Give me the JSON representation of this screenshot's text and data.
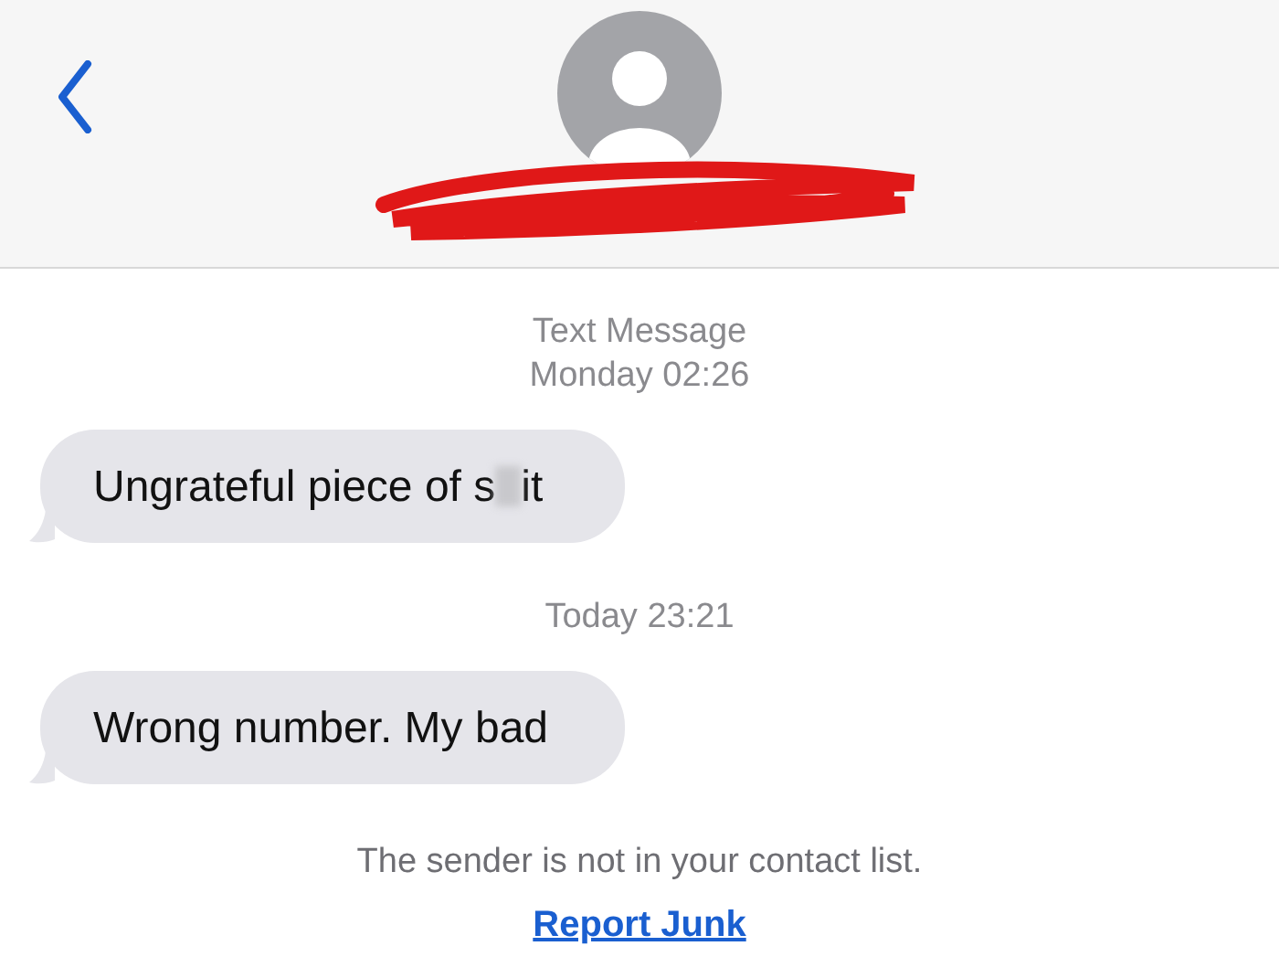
{
  "thread": [
    {
      "kind": "time",
      "label": "Text Message",
      "time": "Monday 02:26"
    },
    {
      "kind": "message",
      "text": "Ungrateful piece of s",
      "censored": true,
      "text_after": "it"
    },
    {
      "kind": "time",
      "time": "Today 23:21"
    },
    {
      "kind": "message",
      "text": "Wrong number. My bad",
      "censored": false
    }
  ],
  "footer": {
    "notice": "The sender is not in your contact list.",
    "link": "Report Junk"
  }
}
